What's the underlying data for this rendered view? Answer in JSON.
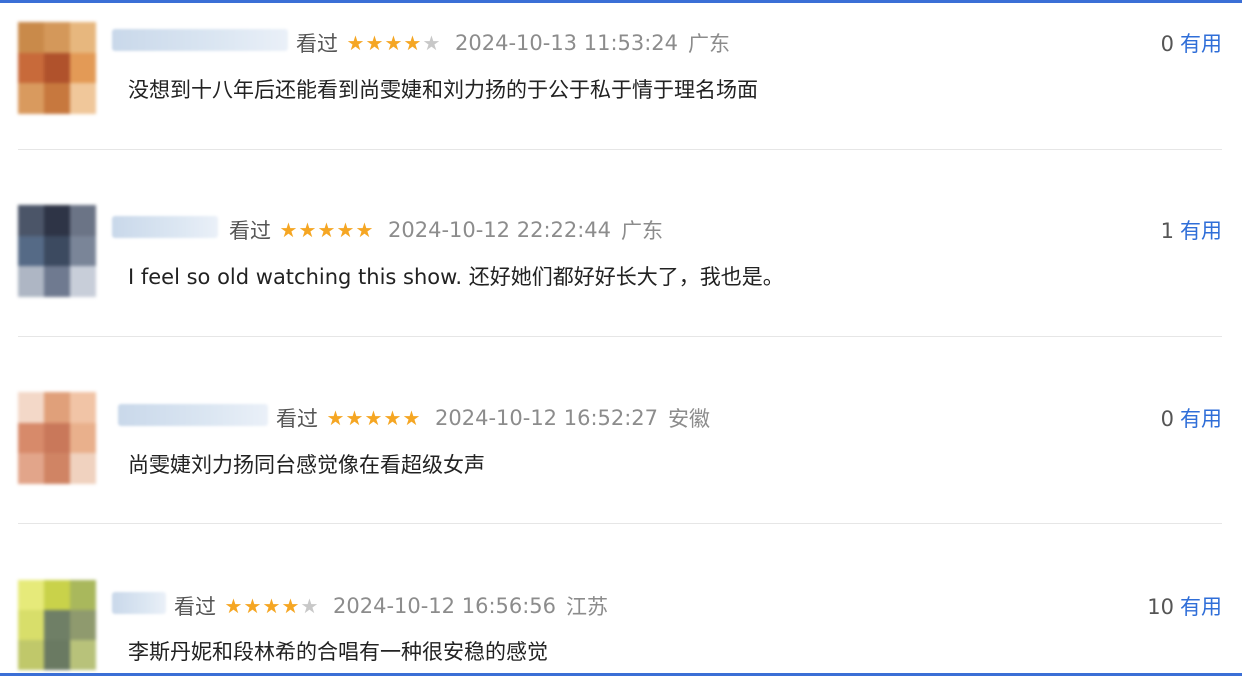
{
  "comments": [
    {
      "watched": "看过",
      "stars": [
        1,
        1,
        1,
        1,
        0
      ],
      "date": "2024-10-13 11:53:24",
      "location": "广东",
      "useful_count": "0",
      "useful_label": "有用",
      "text": "没想到十八年后还能看到尚雯婕和刘力扬的于公于私于情于理名场面",
      "avatar_colors": [
        "#c98a4a",
        "#d4985a",
        "#e7b77e",
        "#c86a3a",
        "#b0522c",
        "#e39a56",
        "#d99a5e",
        "#c7783e",
        "#f0c79a"
      ]
    },
    {
      "watched": "看过",
      "stars": [
        1,
        1,
        1,
        1,
        1
      ],
      "date": "2024-10-12 22:22:44",
      "location": "广东",
      "useful_count": "1",
      "useful_label": "有用",
      "text": "I feel so old watching this show. 还好她们都好好长大了，我也是。",
      "avatar_colors": [
        "#4b5568",
        "#2e3446",
        "#6b7486",
        "#556a86",
        "#3c4a60",
        "#7a8598",
        "#aeb6c4",
        "#6f7a90",
        "#c8ced9"
      ]
    },
    {
      "watched": "看过",
      "stars": [
        1,
        1,
        1,
        1,
        1
      ],
      "date": "2024-10-12 16:52:27",
      "location": "安徽",
      "useful_count": "0",
      "useful_label": "有用",
      "text": "尚雯婕刘力扬同台感觉像在看超级女声",
      "avatar_colors": [
        "#f3d8c8",
        "#e0a07a",
        "#f1c4a6",
        "#d78a6a",
        "#c9785a",
        "#e9b08c",
        "#e2a58a",
        "#d08464",
        "#f0d2bf"
      ]
    },
    {
      "watched": "看过",
      "stars": [
        1,
        1,
        1,
        1,
        0
      ],
      "date": "2024-10-12 16:56:56",
      "location": "江苏",
      "useful_count": "10",
      "useful_label": "有用",
      "text": "李斯丹妮和段林希的合唱有一种很安稳的感觉",
      "avatar_colors": [
        "#e6ea7a",
        "#c9d24a",
        "#a9b85c",
        "#d8de6a",
        "#6f7f66",
        "#8f9a6e",
        "#c0c86a",
        "#6a7a62",
        "#b8c27a"
      ]
    }
  ]
}
